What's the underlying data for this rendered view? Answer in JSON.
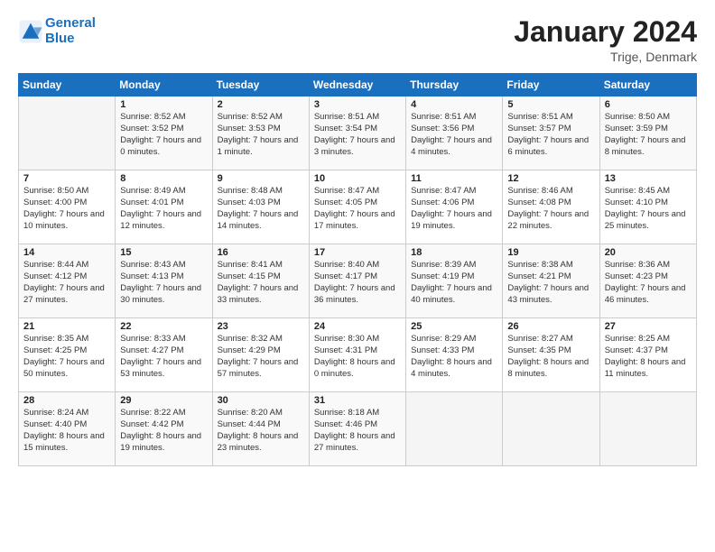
{
  "header": {
    "logo_line1": "General",
    "logo_line2": "Blue",
    "month_year": "January 2024",
    "location": "Trige, Denmark"
  },
  "weekdays": [
    "Sunday",
    "Monday",
    "Tuesday",
    "Wednesday",
    "Thursday",
    "Friday",
    "Saturday"
  ],
  "weeks": [
    [
      {
        "day": "",
        "sunrise": "",
        "sunset": "",
        "daylight": ""
      },
      {
        "day": "1",
        "sunrise": "Sunrise: 8:52 AM",
        "sunset": "Sunset: 3:52 PM",
        "daylight": "Daylight: 7 hours and 0 minutes."
      },
      {
        "day": "2",
        "sunrise": "Sunrise: 8:52 AM",
        "sunset": "Sunset: 3:53 PM",
        "daylight": "Daylight: 7 hours and 1 minute."
      },
      {
        "day": "3",
        "sunrise": "Sunrise: 8:51 AM",
        "sunset": "Sunset: 3:54 PM",
        "daylight": "Daylight: 7 hours and 3 minutes."
      },
      {
        "day": "4",
        "sunrise": "Sunrise: 8:51 AM",
        "sunset": "Sunset: 3:56 PM",
        "daylight": "Daylight: 7 hours and 4 minutes."
      },
      {
        "day": "5",
        "sunrise": "Sunrise: 8:51 AM",
        "sunset": "Sunset: 3:57 PM",
        "daylight": "Daylight: 7 hours and 6 minutes."
      },
      {
        "day": "6",
        "sunrise": "Sunrise: 8:50 AM",
        "sunset": "Sunset: 3:59 PM",
        "daylight": "Daylight: 7 hours and 8 minutes."
      }
    ],
    [
      {
        "day": "7",
        "sunrise": "Sunrise: 8:50 AM",
        "sunset": "Sunset: 4:00 PM",
        "daylight": "Daylight: 7 hours and 10 minutes."
      },
      {
        "day": "8",
        "sunrise": "Sunrise: 8:49 AM",
        "sunset": "Sunset: 4:01 PM",
        "daylight": "Daylight: 7 hours and 12 minutes."
      },
      {
        "day": "9",
        "sunrise": "Sunrise: 8:48 AM",
        "sunset": "Sunset: 4:03 PM",
        "daylight": "Daylight: 7 hours and 14 minutes."
      },
      {
        "day": "10",
        "sunrise": "Sunrise: 8:47 AM",
        "sunset": "Sunset: 4:05 PM",
        "daylight": "Daylight: 7 hours and 17 minutes."
      },
      {
        "day": "11",
        "sunrise": "Sunrise: 8:47 AM",
        "sunset": "Sunset: 4:06 PM",
        "daylight": "Daylight: 7 hours and 19 minutes."
      },
      {
        "day": "12",
        "sunrise": "Sunrise: 8:46 AM",
        "sunset": "Sunset: 4:08 PM",
        "daylight": "Daylight: 7 hours and 22 minutes."
      },
      {
        "day": "13",
        "sunrise": "Sunrise: 8:45 AM",
        "sunset": "Sunset: 4:10 PM",
        "daylight": "Daylight: 7 hours and 25 minutes."
      }
    ],
    [
      {
        "day": "14",
        "sunrise": "Sunrise: 8:44 AM",
        "sunset": "Sunset: 4:12 PM",
        "daylight": "Daylight: 7 hours and 27 minutes."
      },
      {
        "day": "15",
        "sunrise": "Sunrise: 8:43 AM",
        "sunset": "Sunset: 4:13 PM",
        "daylight": "Daylight: 7 hours and 30 minutes."
      },
      {
        "day": "16",
        "sunrise": "Sunrise: 8:41 AM",
        "sunset": "Sunset: 4:15 PM",
        "daylight": "Daylight: 7 hours and 33 minutes."
      },
      {
        "day": "17",
        "sunrise": "Sunrise: 8:40 AM",
        "sunset": "Sunset: 4:17 PM",
        "daylight": "Daylight: 7 hours and 36 minutes."
      },
      {
        "day": "18",
        "sunrise": "Sunrise: 8:39 AM",
        "sunset": "Sunset: 4:19 PM",
        "daylight": "Daylight: 7 hours and 40 minutes."
      },
      {
        "day": "19",
        "sunrise": "Sunrise: 8:38 AM",
        "sunset": "Sunset: 4:21 PM",
        "daylight": "Daylight: 7 hours and 43 minutes."
      },
      {
        "day": "20",
        "sunrise": "Sunrise: 8:36 AM",
        "sunset": "Sunset: 4:23 PM",
        "daylight": "Daylight: 7 hours and 46 minutes."
      }
    ],
    [
      {
        "day": "21",
        "sunrise": "Sunrise: 8:35 AM",
        "sunset": "Sunset: 4:25 PM",
        "daylight": "Daylight: 7 hours and 50 minutes."
      },
      {
        "day": "22",
        "sunrise": "Sunrise: 8:33 AM",
        "sunset": "Sunset: 4:27 PM",
        "daylight": "Daylight: 7 hours and 53 minutes."
      },
      {
        "day": "23",
        "sunrise": "Sunrise: 8:32 AM",
        "sunset": "Sunset: 4:29 PM",
        "daylight": "Daylight: 7 hours and 57 minutes."
      },
      {
        "day": "24",
        "sunrise": "Sunrise: 8:30 AM",
        "sunset": "Sunset: 4:31 PM",
        "daylight": "Daylight: 8 hours and 0 minutes."
      },
      {
        "day": "25",
        "sunrise": "Sunrise: 8:29 AM",
        "sunset": "Sunset: 4:33 PM",
        "daylight": "Daylight: 8 hours and 4 minutes."
      },
      {
        "day": "26",
        "sunrise": "Sunrise: 8:27 AM",
        "sunset": "Sunset: 4:35 PM",
        "daylight": "Daylight: 8 hours and 8 minutes."
      },
      {
        "day": "27",
        "sunrise": "Sunrise: 8:25 AM",
        "sunset": "Sunset: 4:37 PM",
        "daylight": "Daylight: 8 hours and 11 minutes."
      }
    ],
    [
      {
        "day": "28",
        "sunrise": "Sunrise: 8:24 AM",
        "sunset": "Sunset: 4:40 PM",
        "daylight": "Daylight: 8 hours and 15 minutes."
      },
      {
        "day": "29",
        "sunrise": "Sunrise: 8:22 AM",
        "sunset": "Sunset: 4:42 PM",
        "daylight": "Daylight: 8 hours and 19 minutes."
      },
      {
        "day": "30",
        "sunrise": "Sunrise: 8:20 AM",
        "sunset": "Sunset: 4:44 PM",
        "daylight": "Daylight: 8 hours and 23 minutes."
      },
      {
        "day": "31",
        "sunrise": "Sunrise: 8:18 AM",
        "sunset": "Sunset: 4:46 PM",
        "daylight": "Daylight: 8 hours and 27 minutes."
      },
      {
        "day": "",
        "sunrise": "",
        "sunset": "",
        "daylight": ""
      },
      {
        "day": "",
        "sunrise": "",
        "sunset": "",
        "daylight": ""
      },
      {
        "day": "",
        "sunrise": "",
        "sunset": "",
        "daylight": ""
      }
    ]
  ]
}
